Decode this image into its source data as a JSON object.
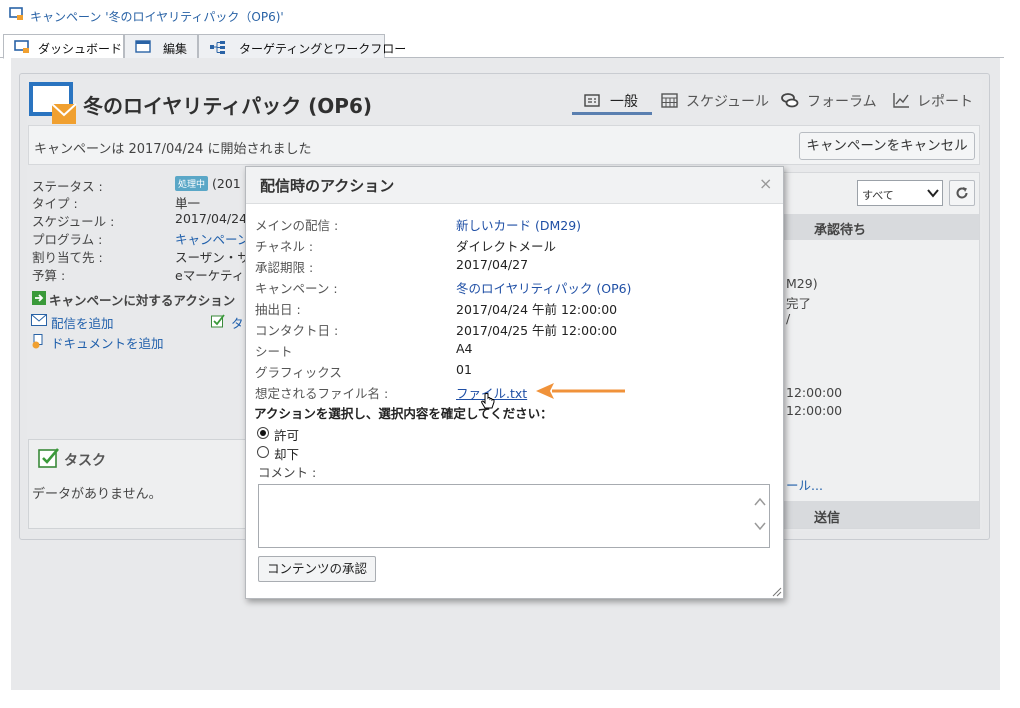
{
  "window": {
    "title": "キャンペーン '冬のロイヤリティパック（OP6)'"
  },
  "tabs": [
    {
      "label": "ダッシュボード",
      "icon": "dashboard-icon",
      "active": true
    },
    {
      "label": "編集",
      "icon": "edit-icon",
      "active": false
    },
    {
      "label": "ターゲティングとワークフロー",
      "icon": "workflow-icon",
      "active": false
    }
  ],
  "campaign": {
    "title": "冬のロイヤリティパック (OP6)",
    "started_text": "キャンペーンは 2017/04/24 に開始されました",
    "cancel_label": "キャンペーンをキャンセル"
  },
  "nav_tabs": [
    {
      "label": "一般",
      "icon": "general-icon",
      "active": true
    },
    {
      "label": "スケジュール",
      "icon": "calendar-icon",
      "active": false
    },
    {
      "label": "フォーラム",
      "icon": "forum-icon",
      "active": false
    },
    {
      "label": "レポート",
      "icon": "report-icon",
      "active": false
    }
  ],
  "properties": [
    {
      "label": "ステータス :",
      "value": "(201",
      "badge": "処理中"
    },
    {
      "label": "タイプ :",
      "value": "単一"
    },
    {
      "label": "スケジュール :",
      "value": "2017/04/24"
    },
    {
      "label": "プログラム :",
      "value": "キャンペーン"
    },
    {
      "label": "割り当て先 :",
      "value": "スーザン・サ"
    },
    {
      "label": "予算 :",
      "value": "eマーケティ"
    }
  ],
  "actions": {
    "header": "キャンペーンに対するアクション",
    "add_delivery": "配信を追加",
    "add_document": "ドキュメントを追加",
    "add_task_partial": "タ"
  },
  "tasks": {
    "title": "タスク",
    "empty": "データがありません。"
  },
  "right_panel": {
    "filter_value": "すべて",
    "pending_header": "承認待ち",
    "lines": [
      "M29)",
      "完了",
      "/",
      "12:00:00",
      "12:00:00",
      "ール..."
    ],
    "send_header": "送信"
  },
  "modal": {
    "title": "配信時のアクション",
    "close": "×",
    "fields": [
      {
        "label": "メインの配信 :",
        "value": "新しいカード (DM29)",
        "link": true
      },
      {
        "label": "チャネル :",
        "value": "ダイレクトメール"
      },
      {
        "label": "承認期限 :",
        "value": "2017/04/27"
      },
      {
        "label": "キャンペーン :",
        "value": "冬のロイヤリティパック (OP6)",
        "link": true
      },
      {
        "label": "抽出日 :",
        "value": "2017/04/24 午前 12:00:00"
      },
      {
        "label": "コンタクト日 :",
        "value": "2017/04/25 午前 12:00:00"
      },
      {
        "label": "シート",
        "value": "A4"
      },
      {
        "label": "グラフィックス",
        "value": "01"
      },
      {
        "label": "想定されるファイル名 :",
        "value": "ファイル.txt",
        "link": true
      }
    ],
    "prompt": "アクションを選択し、選択内容を確定してください：",
    "options": [
      {
        "label": "許可",
        "selected": true
      },
      {
        "label": "却下",
        "selected": false
      }
    ],
    "comment_label": "コメント :",
    "comment_value": "",
    "approve_label": "コンテンツの承認"
  },
  "colors": {
    "accent": "#1f5fab",
    "arrow": "#f0923a",
    "badge": "#5aa7c7"
  }
}
